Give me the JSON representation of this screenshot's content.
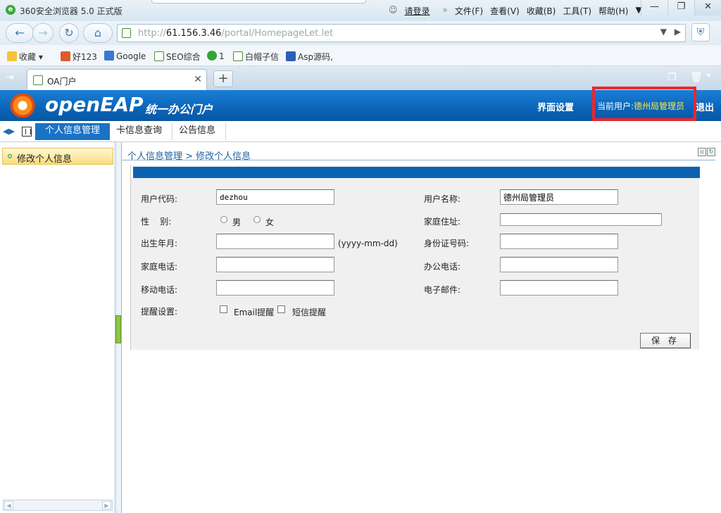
{
  "browser": {
    "title": "360安全浏览器 5.0 正式版",
    "login": "请登录",
    "menu": [
      "文件(F)",
      "查看(V)",
      "收藏(B)",
      "工具(T)",
      "帮助(H)"
    ],
    "url_prefix": "http://",
    "url_host": "61.156.3.46",
    "url_path": "/portal/HomepageLet.let",
    "favorites": [
      "收藏",
      "好123",
      "Google",
      "SEO综合",
      "1",
      "白帽子信",
      "Asp源码,"
    ],
    "tab_title": "OA门户"
  },
  "app": {
    "brand": "openEAP",
    "subtitle": "统一办公门户",
    "settings": "界面设置",
    "current_user_label": "当前用户:",
    "current_user_name": "德州局管理员",
    "logout": "退出",
    "module_tabs": [
      "个人信息管理",
      "卡信息查询",
      "公告信息"
    ],
    "sidebar_item": "修改个人信息",
    "breadcrumb": "个人信息管理  > 修改个人信息",
    "accent_color": "#1b73c6",
    "highlight_color": "#e8282d"
  },
  "form": {
    "user_code_label": "用户代码:",
    "user_code_value": "dezhou",
    "user_name_label": "用户名称:",
    "user_name_value": "德州局管理员",
    "gender_label": "性    别:",
    "gender_male": "男",
    "gender_female": "女",
    "home_address_label": "家庭住址:",
    "home_address_value": "",
    "birth_label": "出生年月:",
    "birth_value": "",
    "birth_hint": "(yyyy-mm-dd)",
    "id_number_label": "身份证号码:",
    "id_number_value": "",
    "home_phone_label": "家庭电话:",
    "home_phone_value": "",
    "office_phone_label": "办公电话:",
    "office_phone_value": "",
    "mobile_label": "移动电话:",
    "mobile_value": "",
    "email_label": "电子邮件:",
    "email_value": "",
    "reminder_label": "提醒设置:",
    "email_reminder": "Email提醒",
    "sms_reminder": "短信提醒",
    "save": "保 存"
  }
}
